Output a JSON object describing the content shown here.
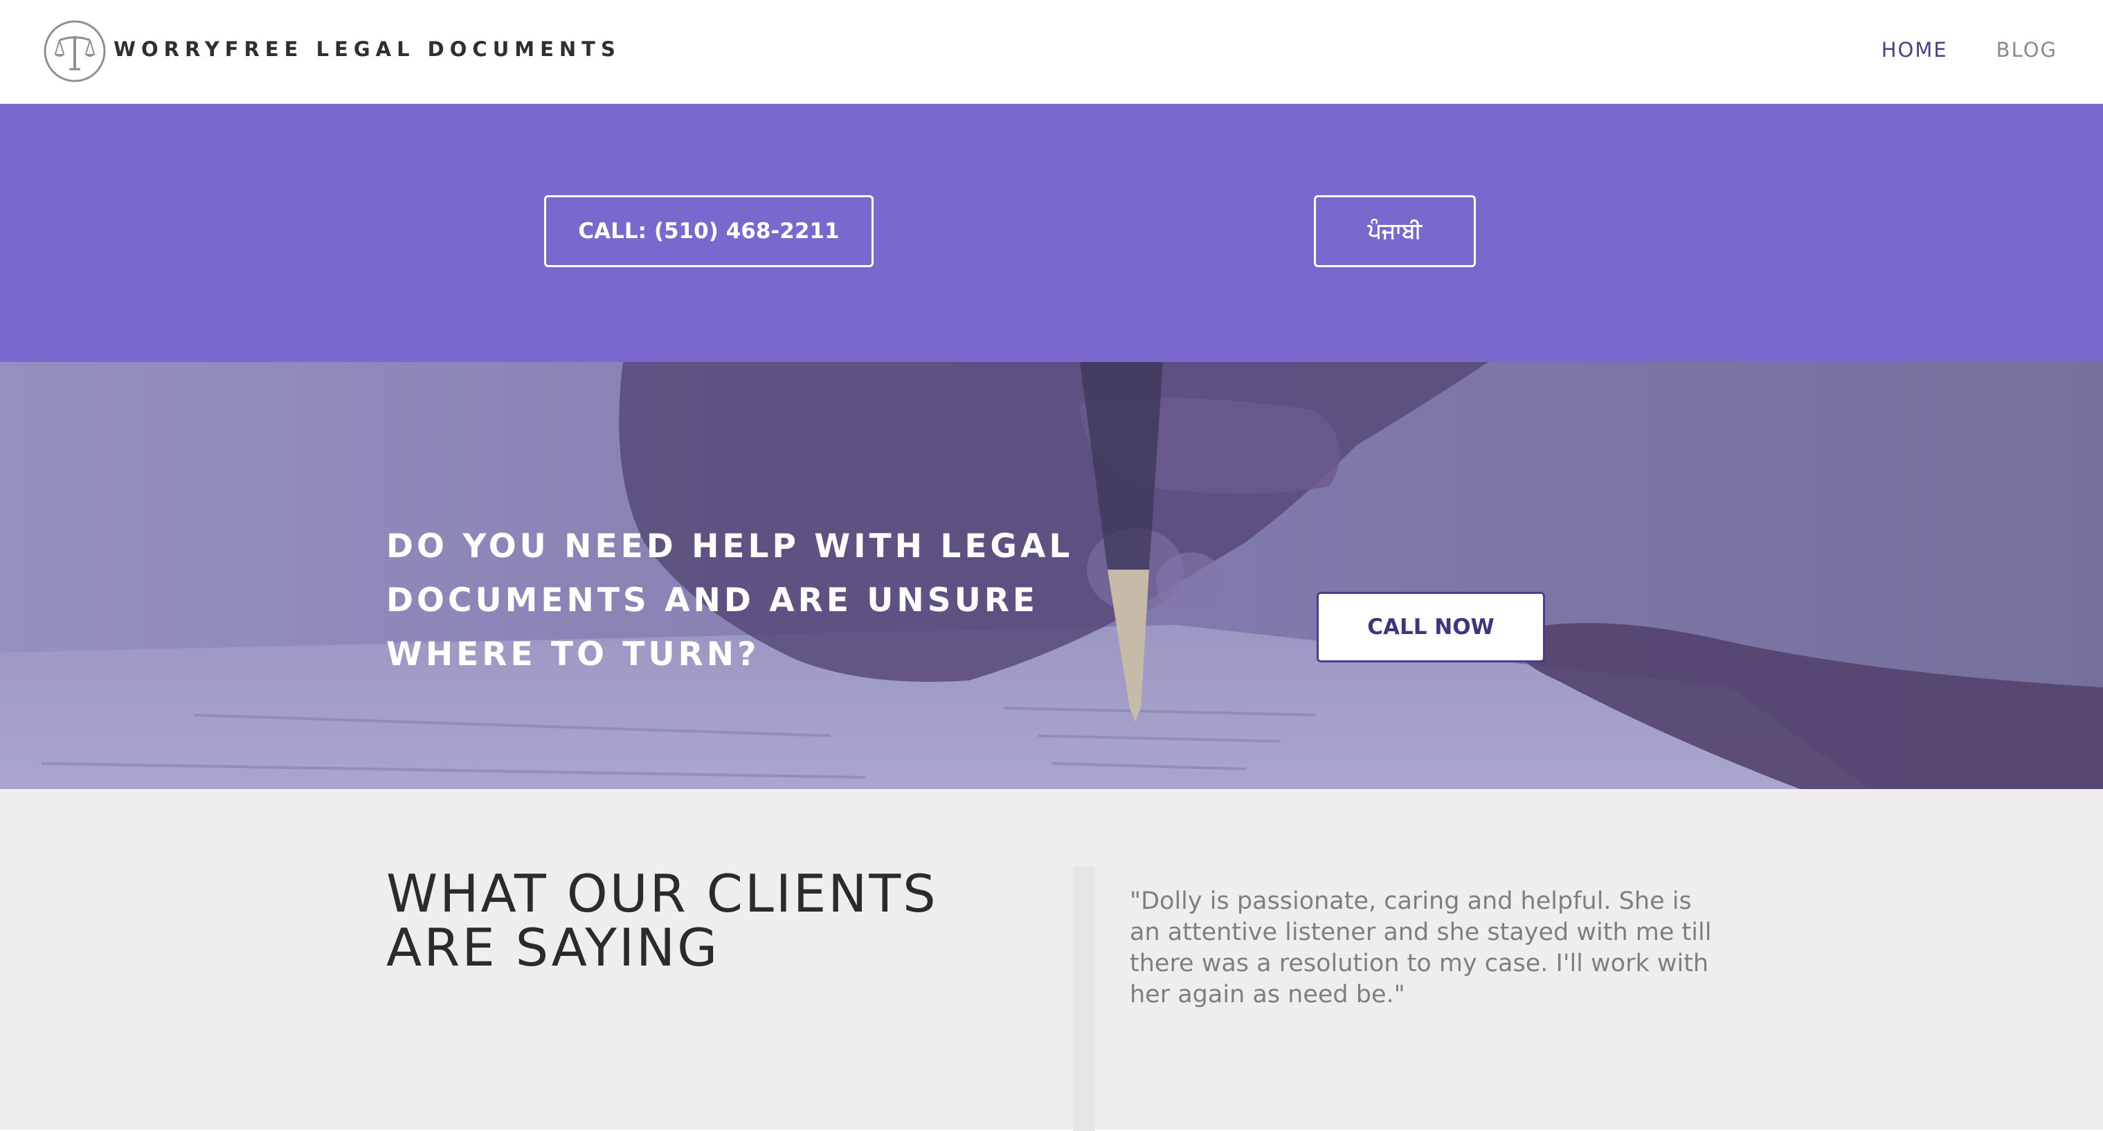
{
  "header": {
    "brand": "WORRYFREE LEGAL DOCUMENTS",
    "logo_icon": "scales-of-justice-icon",
    "nav": [
      {
        "label": "HOME",
        "active": true
      },
      {
        "label": "BLOG",
        "active": false
      }
    ]
  },
  "band": {
    "call_label": "CALL: (510) 468-2211",
    "language_label": "ਪੰਜਾਬੀ",
    "background_color": "#7b68cf"
  },
  "hero": {
    "title": "DO YOU NEED HELP WITH LEGAL DOCUMENTS AND ARE UNSURE WHERE TO TURN?",
    "cta_label": "CALL NOW"
  },
  "testimonials": {
    "heading": "WHAT OUR CLIENTS ARE SAYING",
    "quote": "\"Dolly is passionate, caring and helpful. She is an attentive listener and she stayed with me till there was a resolution to my case. I'll work with her again as need be.\""
  },
  "colors": {
    "accent": "#7b68cf",
    "nav_active": "#4a3e8a",
    "testimonial_bg": "#efedee"
  }
}
